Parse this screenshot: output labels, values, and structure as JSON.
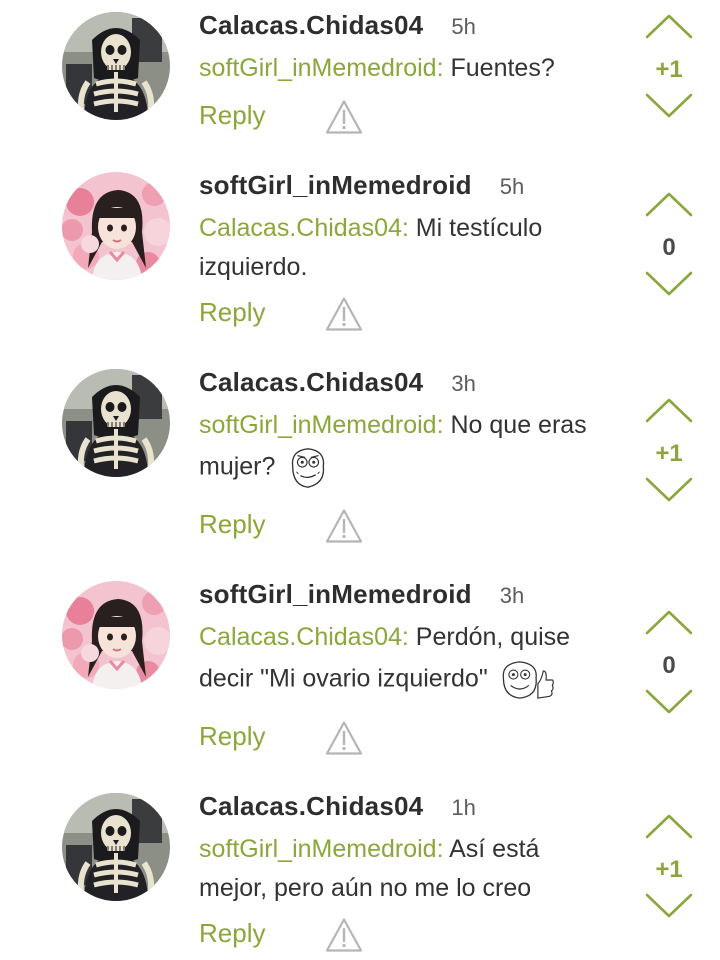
{
  "colors": {
    "accent": "#8aa73b",
    "author": "#2e2e2e",
    "text": "#333333",
    "icon": "#b5b5b5"
  },
  "comments": [
    {
      "author": "Calacas.Chidas04",
      "time": "5h",
      "mention": "softGirl_inMemedroid:",
      "text": "Fuentes?",
      "reply_label": "Reply",
      "score": "+1",
      "avatar_icon": "skeleton-avatar"
    },
    {
      "author": "softGirl_inMemedroid",
      "time": "5h",
      "mention": "Calacas.Chidas04:",
      "text": "Mi testículo izquierdo.",
      "reply_label": "Reply",
      "score": "0",
      "avatar_icon": "girl-avatar"
    },
    {
      "author": "Calacas.Chidas04",
      "time": "3h",
      "mention": "softGirl_inMemedroid:",
      "text": "No que eras mujer?",
      "reply_label": "Reply",
      "score": "+1",
      "avatar_icon": "skeleton-avatar",
      "emoji_icon": "rage-face-icon"
    },
    {
      "author": "softGirl_inMemedroid",
      "time": "3h",
      "mention": "Calacas.Chidas04:",
      "text": "Perdón, quise decir \"Mi ovario izquierdo\"",
      "reply_label": "Reply",
      "score": "0",
      "avatar_icon": "girl-avatar",
      "emoji_icon": "thumbs-up-face-icon"
    },
    {
      "author": "Calacas.Chidas04",
      "time": "1h",
      "mention": "softGirl_inMemedroid:",
      "text": "Así está mejor, pero aún no me lo creo",
      "reply_label": "Reply",
      "score": "+1",
      "avatar_icon": "skeleton-avatar"
    }
  ]
}
